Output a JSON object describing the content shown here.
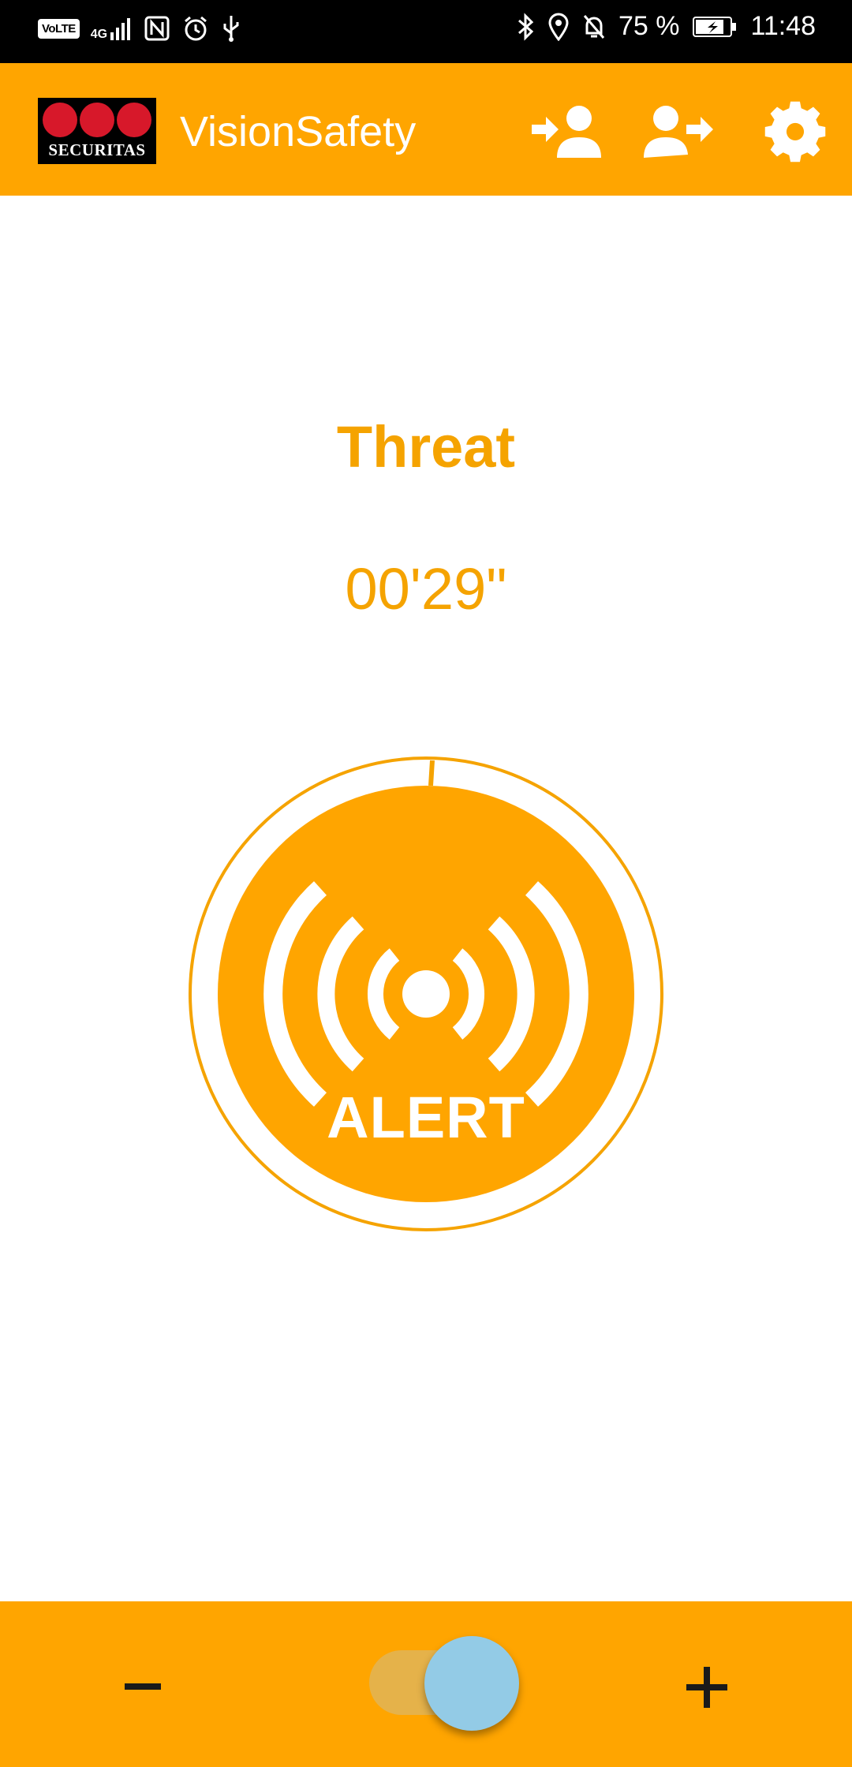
{
  "status_bar": {
    "volte": "VoLTE",
    "network": "4G",
    "battery_percent": "75 %",
    "time": "11:48"
  },
  "app_bar": {
    "logo_text": "SECURITAS",
    "title": "VisionSafety",
    "icons": [
      "login-user-icon",
      "logout-user-icon",
      "gear-icon"
    ]
  },
  "main": {
    "mode": "Threat",
    "timer": "00'29\"",
    "alert_label": "ALERT"
  },
  "bottom_bar": {
    "toggle_on": true
  },
  "colors": {
    "accent": "#ffa500",
    "text_accent": "#f5a300",
    "toggle_thumb": "#93cbe6",
    "logo_red": "#d7182a"
  }
}
